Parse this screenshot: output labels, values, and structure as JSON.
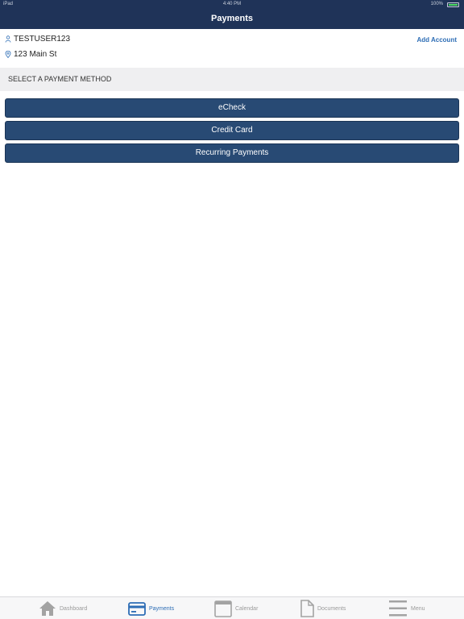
{
  "status_bar": {
    "carrier": "iPad",
    "time": "4:40 PM",
    "battery_percent": "100%",
    "battery_level": 1.0
  },
  "nav": {
    "title": "Payments"
  },
  "account": {
    "username": "TESTUSER123",
    "address": "123 Main St",
    "add_account_label": "Add Account",
    "icons": {
      "user": "person-icon",
      "address": "location-pin-icon"
    }
  },
  "section": {
    "title": "SELECT A PAYMENT METHOD"
  },
  "payment_methods": [
    {
      "label": "eCheck"
    },
    {
      "label": "Credit Card"
    },
    {
      "label": "Recurring Payments"
    }
  ],
  "tabs": [
    {
      "label": "Dashboard",
      "icon": "home-icon",
      "active": false
    },
    {
      "label": "Payments",
      "icon": "credit-card-icon",
      "active": true
    },
    {
      "label": "Calendar",
      "icon": "calendar-icon",
      "active": false
    },
    {
      "label": "Documents",
      "icon": "document-icon",
      "active": false
    },
    {
      "label": "Menu",
      "icon": "hamburger-menu-icon",
      "active": false
    }
  ],
  "colors": {
    "primary": "#1f3358",
    "button": "#284a74",
    "accent": "#2d6db5",
    "inactive": "#9a9a9a"
  }
}
